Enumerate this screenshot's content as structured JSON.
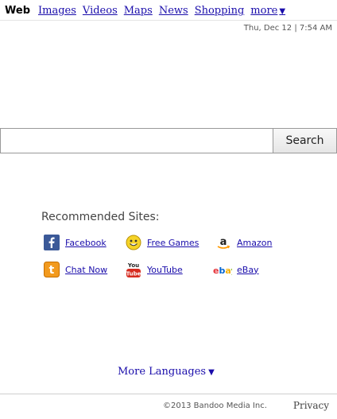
{
  "nav": {
    "items": [
      {
        "label": "Web",
        "active": true
      },
      {
        "label": "Images"
      },
      {
        "label": "Videos"
      },
      {
        "label": "Maps"
      },
      {
        "label": "News"
      },
      {
        "label": "Shopping"
      }
    ],
    "more_label": "more",
    "more_arrow": "▼"
  },
  "datetime": "Thu, Dec 12 | 7:54 AM",
  "search": {
    "value": "",
    "button_label": "Search"
  },
  "recommended": {
    "title": "Recommended Sites:",
    "sites": [
      {
        "label": "Facebook",
        "icon": "facebook-icon"
      },
      {
        "label": "Free Games",
        "icon": "smiley-icon"
      },
      {
        "label": "Amazon",
        "icon": "amazon-icon"
      },
      {
        "label": "Chat Now",
        "icon": "chat-icon"
      },
      {
        "label": "YouTube",
        "icon": "youtube-icon"
      },
      {
        "label": "eBay",
        "icon": "ebay-icon"
      }
    ]
  },
  "more_languages": {
    "label": "More Languages",
    "arrow": "▼"
  },
  "footer": {
    "copyright": "©2013 Bandoo Media Inc.",
    "privacy": "Privacy"
  }
}
